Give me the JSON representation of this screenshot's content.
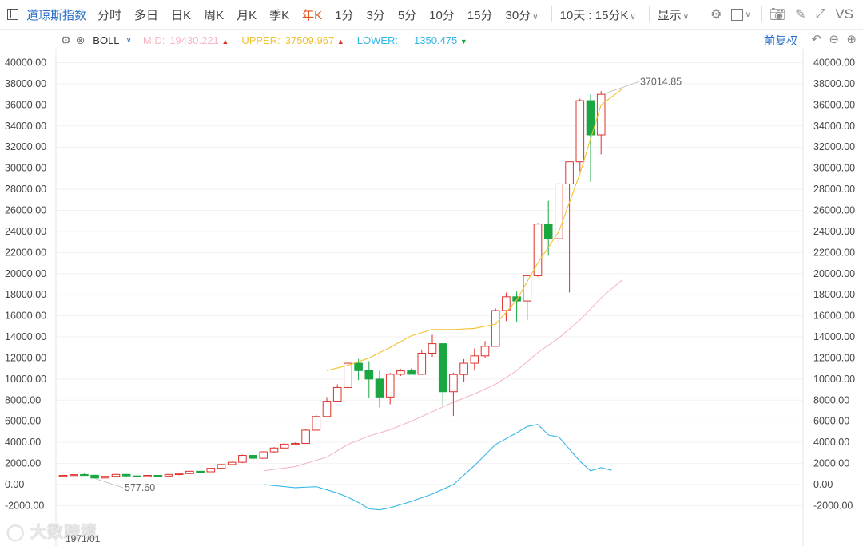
{
  "toolbar": {
    "title": "道琼斯指数",
    "items": [
      "分时",
      "多日",
      "日K",
      "周K",
      "月K",
      "季K",
      "年K",
      "1分",
      "3分",
      "5分",
      "10分",
      "15分",
      "30分"
    ],
    "active": "年K",
    "range_label": "10天 : 15分K",
    "display_label": "显示",
    "vs_label": "VS"
  },
  "indicator": {
    "name": "BOLL",
    "mid_label": "MID:",
    "mid_value": "19430.221",
    "upper_label": "UPPER:",
    "upper_value": "37509.967",
    "lower_label": "LOWER:",
    "lower_value": "1350.475",
    "adjust_label": "前复权",
    "colors": {
      "mid": "#f4b8c4",
      "upper": "#f2c230",
      "lower": "#35b7e8",
      "up": "#e0302a",
      "down": "#1aa640"
    }
  },
  "chart_data": {
    "type": "candlestick",
    "y_ticks": [
      "40000.00",
      "38000.00",
      "36000.00",
      "34000.00",
      "32000.00",
      "30000.00",
      "28000.00",
      "26000.00",
      "24000.00",
      "22000.00",
      "20000.00",
      "18000.00",
      "16000.00",
      "14000.00",
      "12000.00",
      "10000.00",
      "8000.00",
      "6000.00",
      "4000.00",
      "2000.00",
      "0.00",
      "-2000.00"
    ],
    "ylim": [
      -2000,
      40000
    ],
    "max_label": "37014.85",
    "min_label": "577.60",
    "x_start_label": "1971/01",
    "candles": [
      [
        830,
        890,
        810,
        870
      ],
      [
        870,
        960,
        850,
        940
      ],
      [
        950,
        1050,
        880,
        910
      ],
      [
        880,
        920,
        580,
        620
      ],
      [
        620,
        810,
        600,
        780
      ],
      [
        780,
        1010,
        760,
        960
      ],
      [
        960,
        1000,
        720,
        820
      ],
      [
        820,
        870,
        740,
        760
      ],
      [
        760,
        910,
        740,
        870
      ],
      [
        870,
        890,
        780,
        810
      ],
      [
        810,
        1000,
        780,
        960
      ],
      [
        960,
        1080,
        880,
        1040
      ],
      [
        1040,
        1290,
        1010,
        1260
      ],
      [
        1260,
        1300,
        1140,
        1210
      ],
      [
        1210,
        1560,
        1200,
        1540
      ],
      [
        1540,
        1960,
        1450,
        1900
      ],
      [
        1900,
        2170,
        1860,
        2110
      ],
      [
        2110,
        2830,
        2040,
        2760
      ],
      [
        2760,
        2820,
        2140,
        2490
      ],
      [
        2490,
        3150,
        2440,
        3100
      ],
      [
        3100,
        3550,
        3000,
        3460
      ],
      [
        3460,
        3880,
        3450,
        3830
      ],
      [
        3830,
        3990,
        3740,
        3900
      ],
      [
        3900,
        5300,
        3850,
        5150
      ],
      [
        5150,
        6600,
        5100,
        6450
      ],
      [
        6450,
        8300,
        6400,
        7900
      ],
      [
        7900,
        9500,
        7800,
        9200
      ],
      [
        9200,
        11600,
        9100,
        11500
      ],
      [
        11500,
        11900,
        9900,
        10800
      ],
      [
        10800,
        11700,
        8200,
        10000
      ],
      [
        10000,
        10800,
        7300,
        8300
      ],
      [
        8300,
        10600,
        7600,
        10450
      ],
      [
        10450,
        10950,
        10300,
        10780
      ],
      [
        10780,
        11000,
        10500,
        10450
      ],
      [
        10450,
        12800,
        10400,
        12450
      ],
      [
        12450,
        14200,
        12100,
        13350
      ],
      [
        13350,
        13400,
        7500,
        8800
      ],
      [
        8800,
        10600,
        6500,
        10430
      ],
      [
        10430,
        11900,
        9700,
        11500
      ],
      [
        11500,
        12900,
        10800,
        12200
      ],
      [
        12200,
        13600,
        12000,
        13100
      ],
      [
        13100,
        16700,
        13100,
        16500
      ],
      [
        16500,
        18200,
        15500,
        17800
      ],
      [
        17800,
        18300,
        15400,
        17400
      ],
      [
        17400,
        19900,
        15600,
        19800
      ],
      [
        19800,
        24800,
        19700,
        24700
      ],
      [
        24700,
        26900,
        21700,
        23300
      ],
      [
        23300,
        28600,
        22800,
        28500
      ],
      [
        28500,
        30600,
        18200,
        30600
      ],
      [
        30600,
        36600,
        29700,
        36400
      ],
      [
        36400,
        37000,
        28700,
        33150
      ],
      [
        33150,
        37300,
        31300,
        37000
      ]
    ],
    "upper_band": [
      [
        25,
        10800
      ],
      [
        27,
        11300
      ],
      [
        29,
        12000
      ],
      [
        31,
        13000
      ],
      [
        33,
        14100
      ],
      [
        35,
        14700
      ],
      [
        37,
        14700
      ],
      [
        39,
        14800
      ],
      [
        41,
        15200
      ],
      [
        43,
        17500
      ],
      [
        45,
        21000
      ],
      [
        47,
        24000
      ],
      [
        49,
        29500
      ],
      [
        51,
        36000
      ],
      [
        53,
        37500
      ]
    ],
    "mid_band": [
      [
        19,
        1300
      ],
      [
        22,
        1700
      ],
      [
        25,
        2600
      ],
      [
        27,
        3800
      ],
      [
        29,
        4600
      ],
      [
        31,
        5200
      ],
      [
        33,
        6000
      ],
      [
        35,
        6900
      ],
      [
        37,
        7800
      ],
      [
        39,
        8600
      ],
      [
        41,
        9500
      ],
      [
        43,
        10800
      ],
      [
        45,
        12500
      ],
      [
        47,
        13900
      ],
      [
        49,
        15600
      ],
      [
        51,
        17700
      ],
      [
        53,
        19400
      ]
    ],
    "lower_band": [
      [
        19,
        0
      ],
      [
        22,
        -300
      ],
      [
        24,
        -200
      ],
      [
        26,
        -800
      ],
      [
        27,
        -1200
      ],
      [
        28,
        -1700
      ],
      [
        29,
        -2300
      ],
      [
        30,
        -2400
      ],
      [
        31,
        -2200
      ],
      [
        33,
        -1600
      ],
      [
        35,
        -900
      ],
      [
        37,
        0
      ],
      [
        39,
        1800
      ],
      [
        41,
        3800
      ],
      [
        43,
        4900
      ],
      [
        44,
        5500
      ],
      [
        45,
        5700
      ],
      [
        46,
        4700
      ],
      [
        47,
        4500
      ],
      [
        49,
        2200
      ],
      [
        50,
        1300
      ],
      [
        51,
        1600
      ],
      [
        52,
        1350
      ]
    ]
  }
}
